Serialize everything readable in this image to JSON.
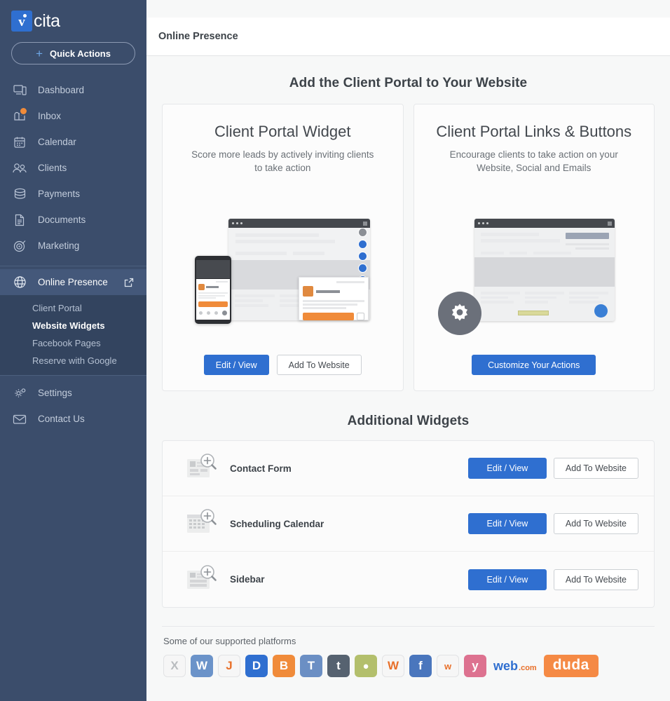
{
  "brand": {
    "logo_letter": "v",
    "logo_word": "cita",
    "logo_bg": "#2f6fd0"
  },
  "sidebar": {
    "quick_actions": {
      "label": "Quick Actions",
      "icon": "plus-icon"
    },
    "items": [
      {
        "label": "Dashboard",
        "icon": "dashboard-icon"
      },
      {
        "label": "Inbox",
        "icon": "inbox-icon",
        "badge": true
      },
      {
        "label": "Calendar",
        "icon": "calendar-icon"
      },
      {
        "label": "Clients",
        "icon": "clients-icon"
      },
      {
        "label": "Payments",
        "icon": "payments-icon"
      },
      {
        "label": "Documents",
        "icon": "documents-icon"
      },
      {
        "label": "Marketing",
        "icon": "marketing-icon"
      }
    ],
    "online_presence": {
      "label": "Online Presence",
      "icon": "globe-icon",
      "external_icon": "external-link-icon"
    },
    "subitems": [
      {
        "label": "Client Portal",
        "selected": false
      },
      {
        "label": "Website Widgets",
        "selected": true
      },
      {
        "label": "Facebook Pages",
        "selected": false
      },
      {
        "label": "Reserve with Google",
        "selected": false
      }
    ],
    "bottom_items": [
      {
        "label": "Settings",
        "icon": "gear-icon"
      },
      {
        "label": "Contact Us",
        "icon": "envelope-icon"
      }
    ]
  },
  "topbar": {
    "title": "Online Presence"
  },
  "main": {
    "section_title": "Add the Client Portal to Your Website",
    "cards": [
      {
        "title": "Client Portal Widget",
        "subtitle": "Score more leads by actively inviting clients to take action",
        "buttons": [
          {
            "label": "Edit / View",
            "style": "primary"
          },
          {
            "label": "Add To Website",
            "style": "default"
          }
        ]
      },
      {
        "title": "Client Portal Links & Buttons",
        "subtitle": "Encourage clients to take action on your Website, Social and Emails",
        "buttons": [
          {
            "label": "Customize Your Actions",
            "style": "primary"
          }
        ]
      }
    ],
    "additional_title": "Additional Widgets",
    "widgets": [
      {
        "name": "Contact Form",
        "icon": "contact-form-icon",
        "edit_label": "Edit / View",
        "add_label": "Add To Website"
      },
      {
        "name": "Scheduling Calendar",
        "icon": "scheduling-calendar-icon",
        "edit_label": "Edit / View",
        "add_label": "Add To Website"
      },
      {
        "name": "Sidebar",
        "icon": "sidebar-widget-icon",
        "edit_label": "Edit / View",
        "add_label": "Add To Website"
      }
    ],
    "platforms_label": "Some of our supported platforms",
    "platforms": [
      {
        "name": "Xara",
        "glyph": "X",
        "bg": "#f6f6f6",
        "fg": "#b9bcbf",
        "light": true
      },
      {
        "name": "WordPress",
        "glyph": "W",
        "bg": "#6b93c9",
        "fg": "#ffffff",
        "light": false
      },
      {
        "name": "Joomla",
        "glyph": "J",
        "bg": "#f6f6f6",
        "fg": "#e8702a",
        "light": true
      },
      {
        "name": "Drupal",
        "glyph": "D",
        "bg": "#2f6fd0",
        "fg": "#ffffff",
        "light": false
      },
      {
        "name": "Blogger",
        "glyph": "B",
        "bg": "#f08b3a",
        "fg": "#ffffff",
        "light": false
      },
      {
        "name": "Typo3",
        "glyph": "T",
        "bg": "#6b8fc4",
        "fg": "#ffffff",
        "light": false
      },
      {
        "name": "Tumblr",
        "glyph": "t",
        "bg": "#566270",
        "fg": "#ffffff",
        "light": false
      },
      {
        "name": "Yahoo",
        "glyph": "●",
        "bg": "#b3bf6c",
        "fg": "#ffffff",
        "light": false
      },
      {
        "name": "Wix",
        "glyph": "W",
        "bg": "#f6f6f6",
        "fg": "#e8702a",
        "light": true
      },
      {
        "name": "Facebook",
        "glyph": "f",
        "bg": "#4a76bd",
        "fg": "#ffffff",
        "light": false
      },
      {
        "name": "Weebly",
        "glyph": "w",
        "bg": "#f6f6f6",
        "fg": "#e8702a",
        "light": true
      },
      {
        "name": "Yola",
        "glyph": "y",
        "bg": "#dd7290",
        "fg": "#ffffff",
        "light": false
      }
    ],
    "webcom": {
      "word": "web",
      "suffix": ".com"
    },
    "duda": {
      "label": "duda"
    }
  }
}
